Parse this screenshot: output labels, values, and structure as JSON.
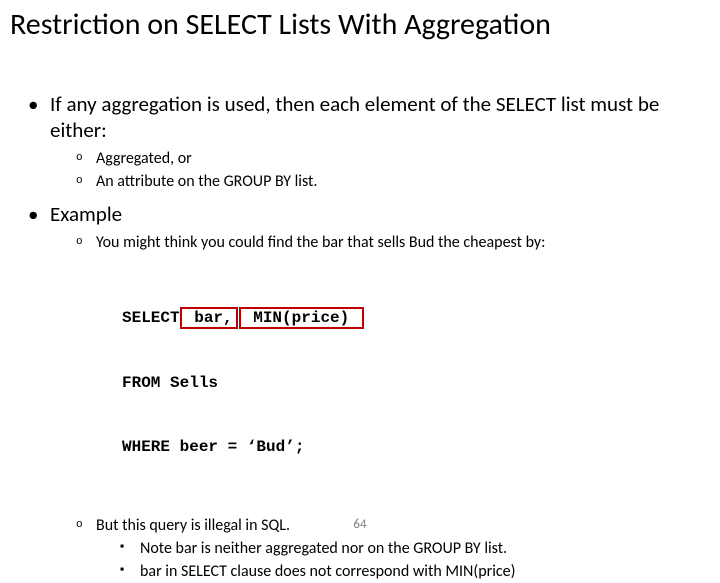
{
  "title": "Restriction on SELECT Lists With Aggregation",
  "b1": "If any aggregation is used, then each element of the SELECT list must be either:",
  "b1s1": "Aggregated, or",
  "b1s2": "An attribute on the GROUP BY list.",
  "b2": "Example",
  "b2s1": "You might think you could find the bar that sells Bud the cheapest by:",
  "code_l1a": "SELECT",
  "code_l1_box1": " bar,",
  "code_l1_box2": " MIN(price) ",
  "code_l2": "FROM Sells",
  "code_l3": "WHERE beer = ‘Bud’;",
  "b2s2": "But this query is illegal in SQL.",
  "b2s2a": "Note bar is neither aggregated nor on the GROUP BY list.",
  "b2s2b": "bar in SELECT clause does not correspond with MIN(price)",
  "pagenum": "64"
}
